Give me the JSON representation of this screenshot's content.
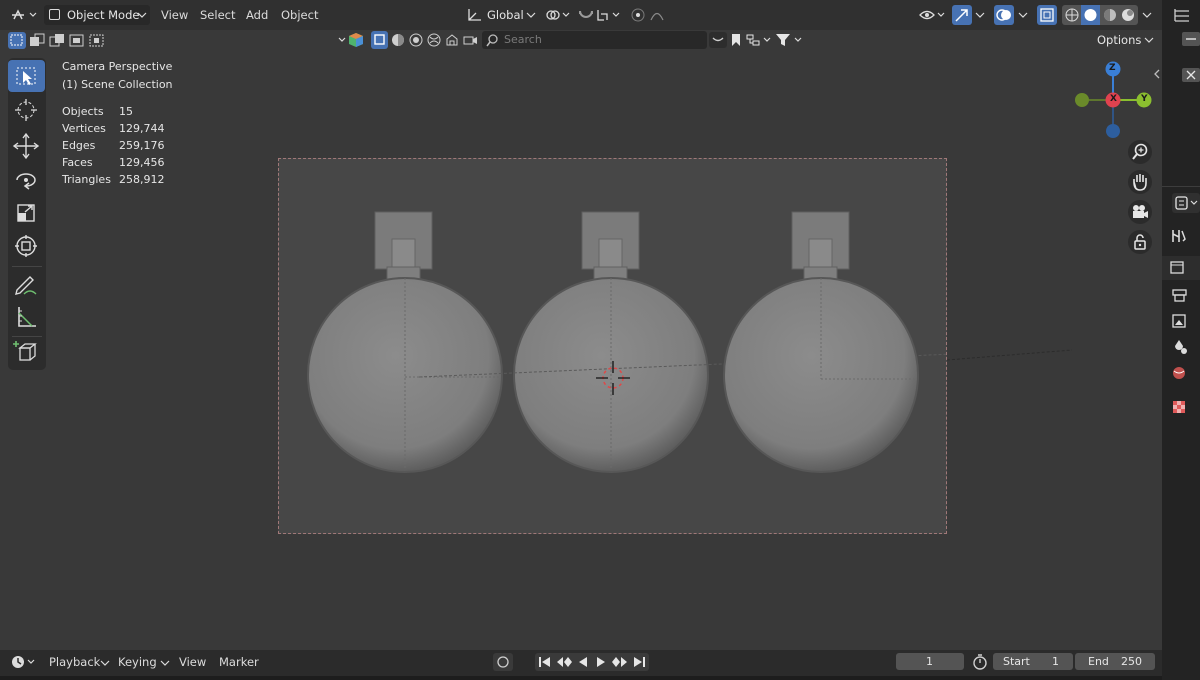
{
  "header": {
    "mode": "Object Mode",
    "menus": [
      "View",
      "Select",
      "Add",
      "Object"
    ],
    "transform_orientation": "Global",
    "options_label": "Options",
    "search_placeholder": "Search"
  },
  "overlay": {
    "camera": "Camera Perspective",
    "collection": "(1) Scene Collection",
    "stats": [
      {
        "label": "Objects",
        "value": "15"
      },
      {
        "label": "Vertices",
        "value": "129,744"
      },
      {
        "label": "Edges",
        "value": "259,176"
      },
      {
        "label": "Faces",
        "value": "129,456"
      },
      {
        "label": "Triangles",
        "value": "258,912"
      }
    ]
  },
  "gizmo": {
    "x": "X",
    "y": "Y",
    "z": "Z"
  },
  "timeline": {
    "menus": [
      "Playback",
      "Keying",
      "View",
      "Marker"
    ],
    "current_frame": "1",
    "start_label": "Start",
    "start_value": "1",
    "end_label": "End",
    "end_value": "250"
  },
  "colors": {
    "accent": "#4772b3",
    "axis_x": "#e0424f",
    "axis_y": "#8bbf2f",
    "axis_z": "#3a7fd6",
    "viewport": "#393939"
  }
}
